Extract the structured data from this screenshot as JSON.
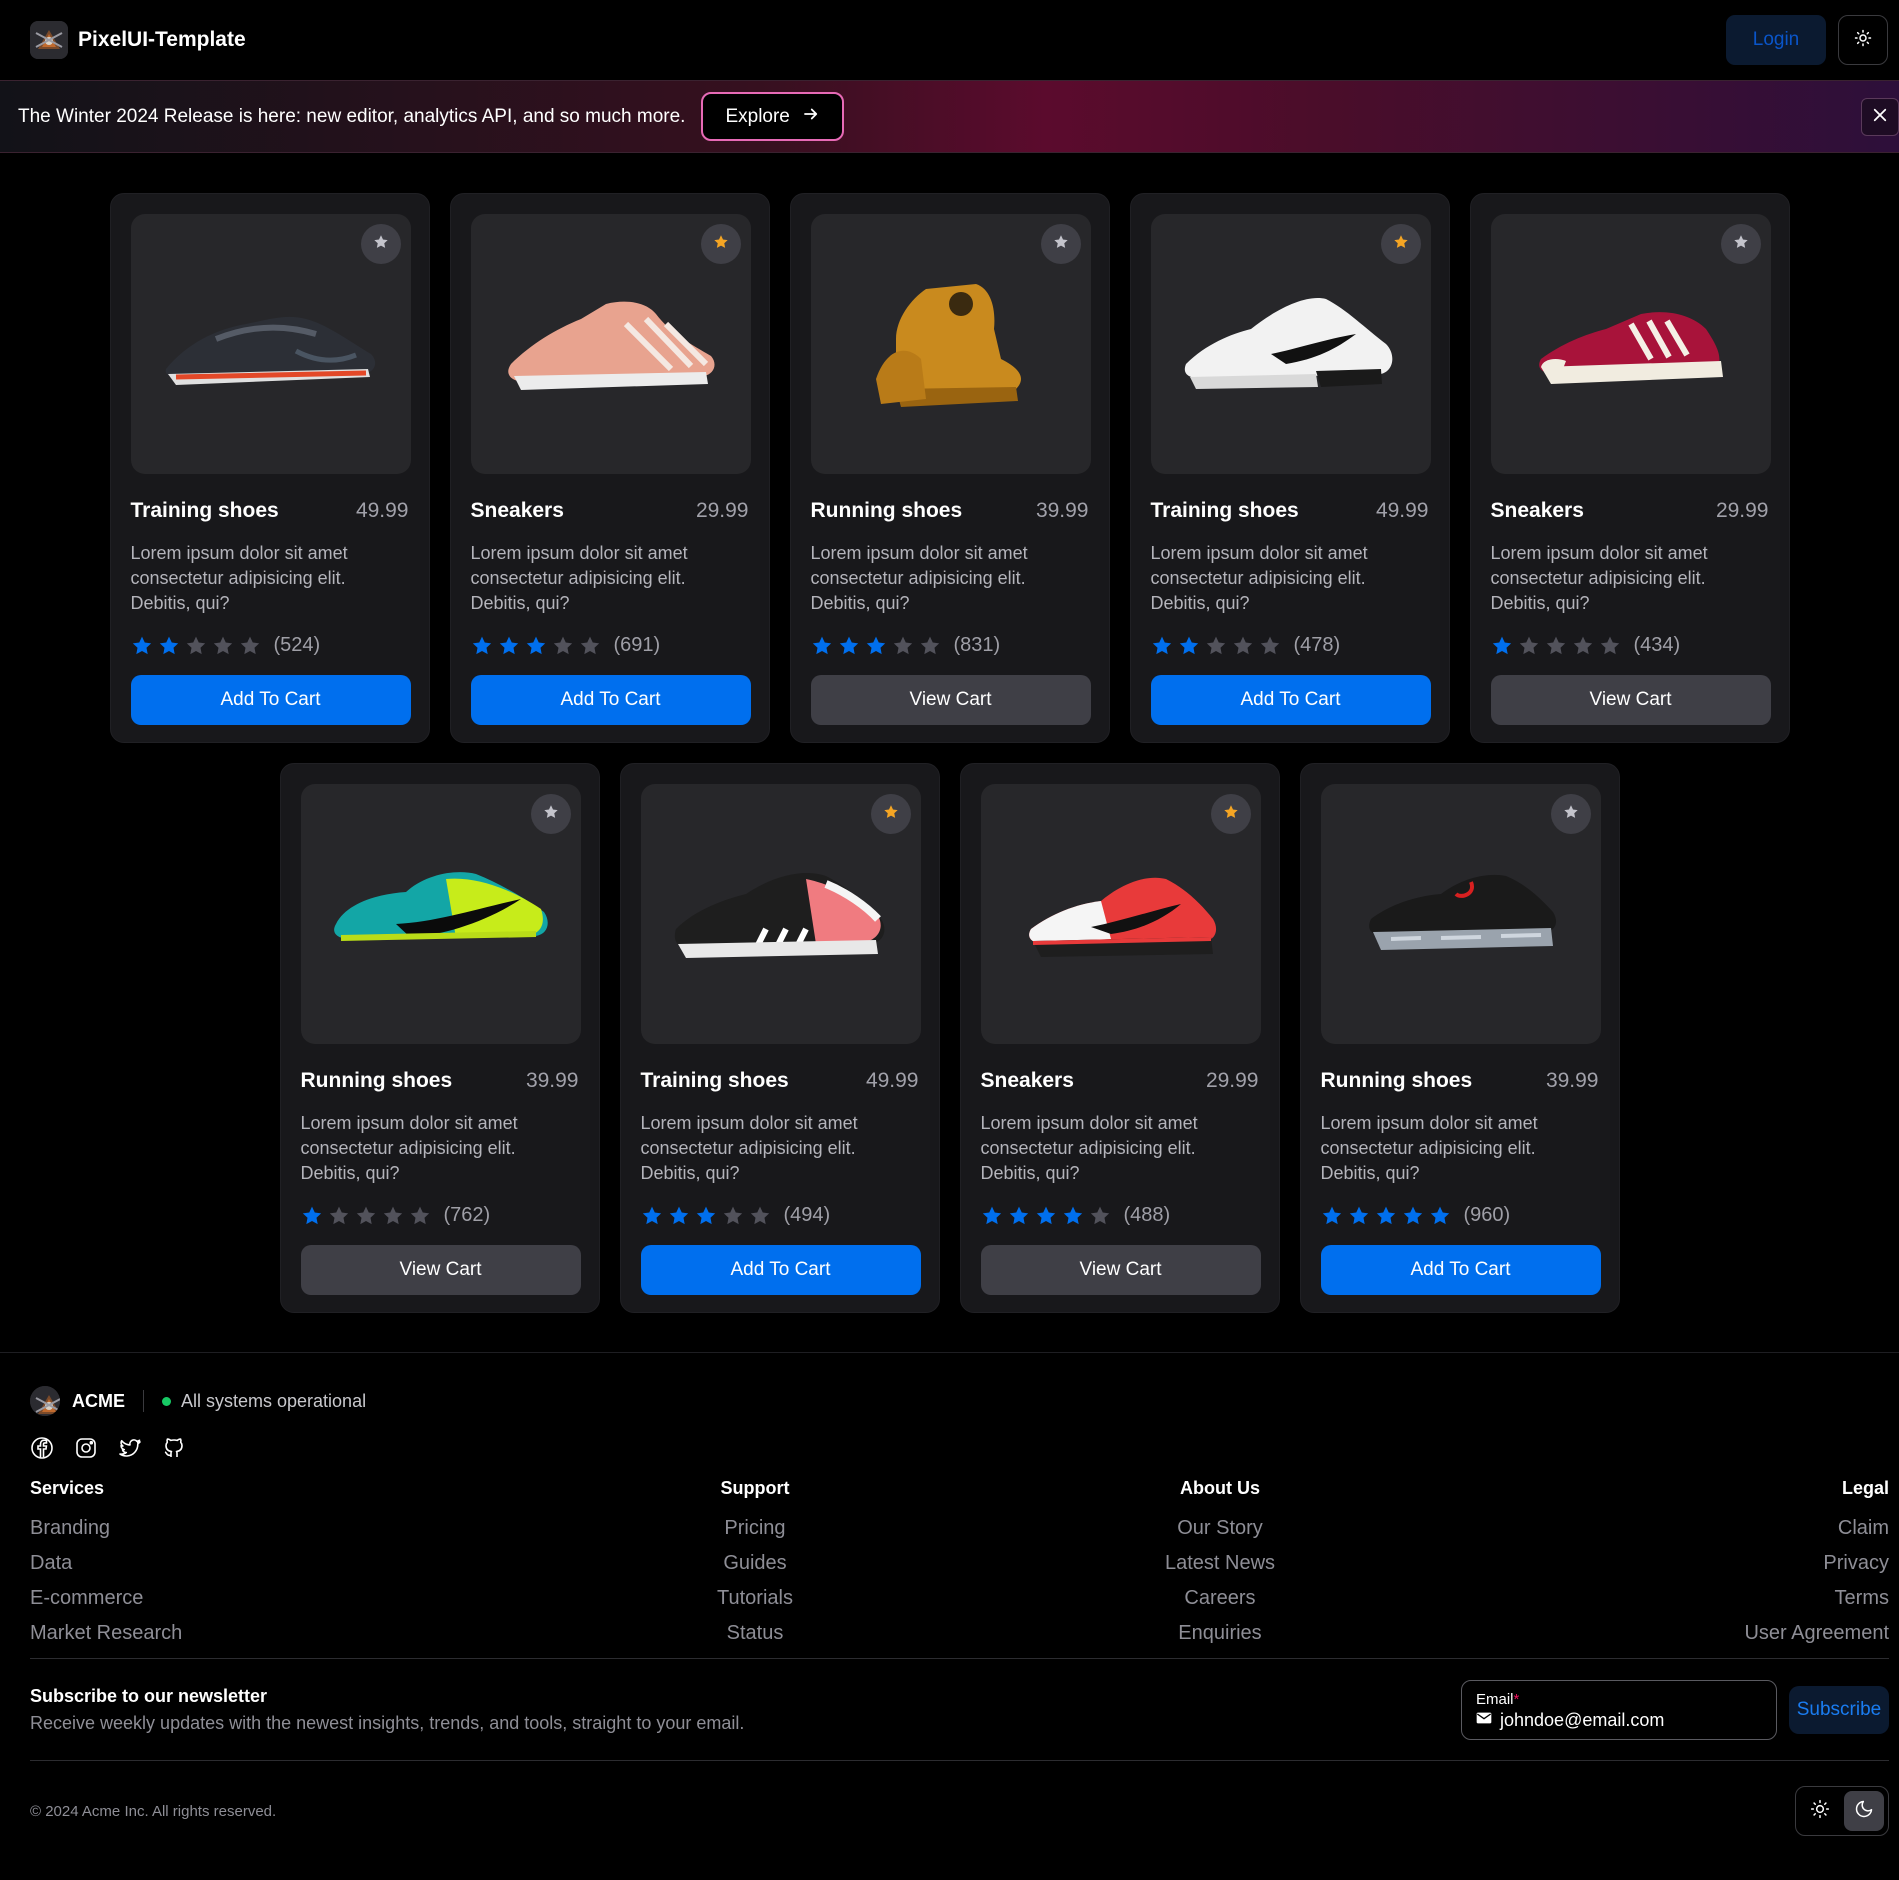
{
  "header": {
    "brand": "PixelUI-Template",
    "login_label": "Login",
    "theme_icon": "sun-icon"
  },
  "banner": {
    "text": "The Winter 2024 Release is here: new editor, analytics API, and so much more.",
    "explore_label": "Explore",
    "explore_icon": "arrow-right-icon",
    "close_icon": "close-icon"
  },
  "products": [
    {
      "title": "Training shoes",
      "price": "49.99",
      "description": "Lorem ipsum dolor sit amet consectetur adipisicing elit. Debitis, qui?",
      "rating": 2,
      "reviews": "(524)",
      "button": "Add To Cart",
      "button_style": "primary",
      "favorite": false,
      "shoe": "black running shoe"
    },
    {
      "title": "Sneakers",
      "price": "29.99",
      "description": "Lorem ipsum dolor sit amet consectetur adipisicing elit. Debitis, qui?",
      "rating": 3,
      "reviews": "(691)",
      "button": "Add To Cart",
      "button_style": "primary",
      "favorite": true,
      "shoe": "pink knit sneaker"
    },
    {
      "title": "Running shoes",
      "price": "39.99",
      "description": "Lorem ipsum dolor sit amet consectetur adipisicing elit. Debitis, qui?",
      "rating": 3,
      "reviews": "(831)",
      "button": "View Cart",
      "button_style": "secondary",
      "favorite": false,
      "shoe": "tan high-top"
    },
    {
      "title": "Training shoes",
      "price": "49.99",
      "description": "Lorem ipsum dolor sit amet consectetur adipisicing elit. Debitis, qui?",
      "rating": 2,
      "reviews": "(478)",
      "button": "Add To Cart",
      "button_style": "primary",
      "favorite": true,
      "shoe": "white air sneaker"
    },
    {
      "title": "Sneakers",
      "price": "29.99",
      "description": "Lorem ipsum dolor sit amet consectetur adipisicing elit. Debitis, qui?",
      "rating": 1,
      "reviews": "(434)",
      "button": "View Cart",
      "button_style": "secondary",
      "favorite": false,
      "shoe": "red suede sneaker"
    },
    {
      "title": "Running shoes",
      "price": "39.99",
      "description": "Lorem ipsum dolor sit amet consectetur adipisicing elit. Debitis, qui?",
      "rating": 1,
      "reviews": "(762)",
      "button": "View Cart",
      "button_style": "secondary",
      "favorite": false,
      "shoe": "teal football boot"
    },
    {
      "title": "Training shoes",
      "price": "49.99",
      "description": "Lorem ipsum dolor sit amet consectetur adipisicing elit. Debitis, qui?",
      "rating": 3,
      "reviews": "(494)",
      "button": "Add To Cart",
      "button_style": "primary",
      "favorite": true,
      "shoe": "black and pink trainer"
    },
    {
      "title": "Sneakers",
      "price": "29.99",
      "description": "Lorem ipsum dolor sit amet consectetur adipisicing elit. Debitis, qui?",
      "rating": 4,
      "reviews": "(488)",
      "button": "View Cart",
      "button_style": "secondary",
      "favorite": true,
      "shoe": "red and white runner"
    },
    {
      "title": "Running shoes",
      "price": "39.99",
      "description": "Lorem ipsum dolor sit amet consectetur adipisicing elit. Debitis, qui?",
      "rating": 5,
      "reviews": "(960)",
      "button": "Add To Cart",
      "button_style": "primary",
      "favorite": false,
      "shoe": "black vapor sneaker"
    }
  ],
  "footer": {
    "brand": "ACME",
    "status": "All systems operational",
    "socials": [
      "facebook-icon",
      "instagram-icon",
      "twitter-icon",
      "github-icon"
    ],
    "columns": [
      {
        "title": "Services",
        "links": [
          "Branding",
          "Data",
          "E-commerce",
          "Market Research"
        ]
      },
      {
        "title": "Support",
        "links": [
          "Pricing",
          "Guides",
          "Tutorials",
          "Status"
        ]
      },
      {
        "title": "About Us",
        "links": [
          "Our Story",
          "Latest News",
          "Careers",
          "Enquiries"
        ]
      },
      {
        "title": "Legal",
        "links": [
          "Claim",
          "Privacy",
          "Terms",
          "User Agreement"
        ]
      }
    ],
    "newsletter": {
      "title": "Subscribe to our newsletter",
      "subtitle": "Receive weekly updates with the newest insights, trends, and tools, straight to your email.",
      "email_label": "Email",
      "required_mark": "*",
      "email_value": "johndoe@email.com",
      "subscribe_label": "Subscribe"
    },
    "copyright": "© 2024 Acme Inc. All rights reserved.",
    "theme_options": [
      "sun-icon",
      "moon-icon"
    ],
    "active_theme": "moon-icon"
  },
  "colors": {
    "accent": "#006fee",
    "star_active": "#006fee",
    "star_inactive": "#52525b",
    "favorite_active": "#f5a524",
    "status_ok": "#17c964"
  }
}
